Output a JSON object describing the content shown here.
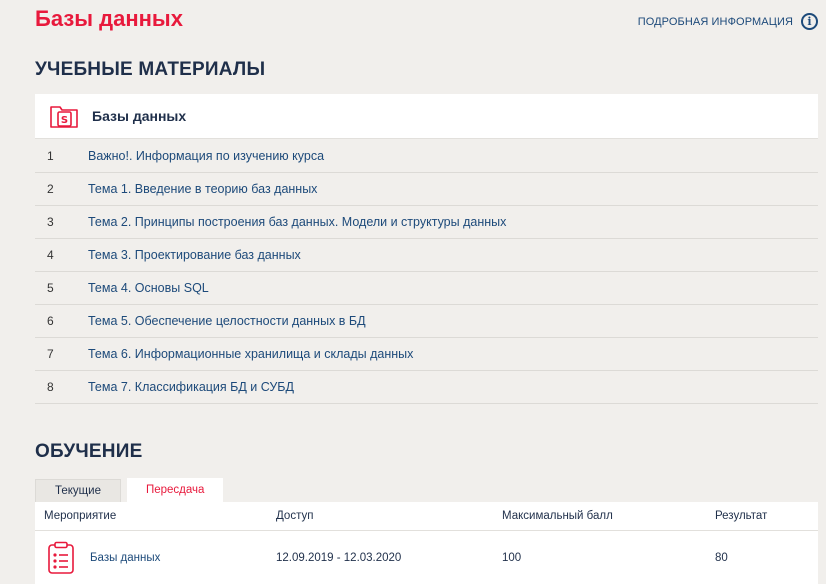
{
  "header": {
    "title": "Базы данных",
    "info_link": "ПОДРОБНАЯ ИНФОРМАЦИЯ",
    "info_icon": "info-circle-icon"
  },
  "materials": {
    "heading": "УЧЕБНЫЕ МАТЕРИАЛЫ",
    "course_name": "Базы данных",
    "items": [
      {
        "num": "1",
        "title": "Важно!. Информация по изучению курса"
      },
      {
        "num": "2",
        "title": "Тема 1. Введение в теорию баз данных"
      },
      {
        "num": "3",
        "title": "Тема 2. Принципы построения баз данных. Модели и структуры данных"
      },
      {
        "num": "4",
        "title": "Тема 3. Проектирование баз данных"
      },
      {
        "num": "5",
        "title": "Тема 4. Основы SQL"
      },
      {
        "num": "6",
        "title": "Тема 5. Обеспечение целостности данных в БД"
      },
      {
        "num": "7",
        "title": "Тема 6. Информационные хранилища и склады данных"
      },
      {
        "num": "8",
        "title": "Тема 7. Классификация БД и СУБД"
      }
    ]
  },
  "learning": {
    "heading": "ОБУЧЕНИЕ",
    "tabs": [
      {
        "label": "Текущие",
        "active": false
      },
      {
        "label": "Пересдача",
        "active": true
      }
    ],
    "columns": [
      "Мероприятие",
      "Доступ",
      "Максимальный балл",
      "Результат"
    ],
    "rows": [
      {
        "event": "Базы данных",
        "access": "12.09.2019 - 12.03.2020",
        "max_score": "100",
        "result": "80"
      }
    ]
  },
  "colors": {
    "accent": "#e8193c",
    "link": "#1d4a7a",
    "background": "#f1efec"
  }
}
